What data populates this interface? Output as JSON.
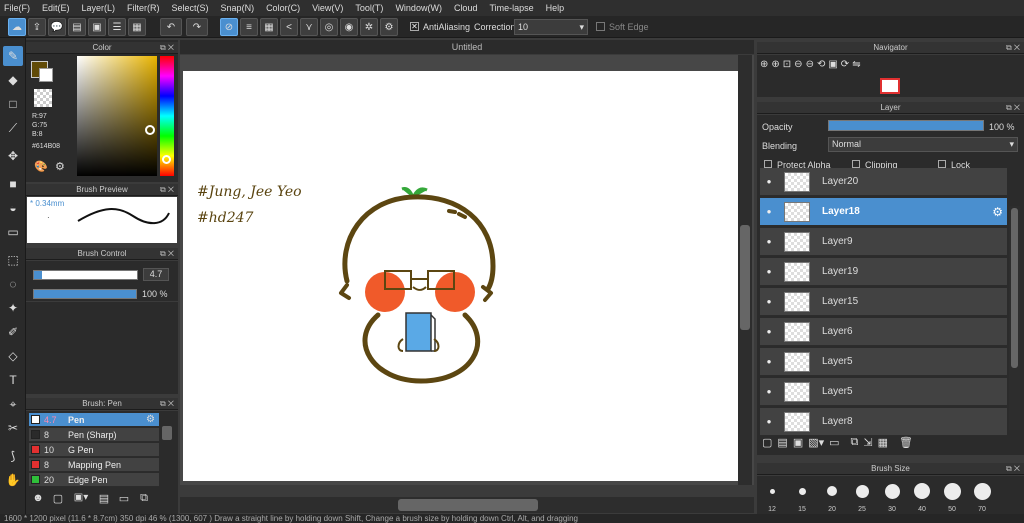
{
  "menu": [
    "File(F)",
    "Edit(E)",
    "Layer(L)",
    "Filter(R)",
    "Select(S)",
    "Snap(N)",
    "Color(C)",
    "View(V)",
    "Tool(T)",
    "Window(W)",
    "Cloud",
    "Time-lapse",
    "Help"
  ],
  "toolbar": {
    "antialias_label": "AntiAliasing",
    "correction_label": "Correction",
    "correction_value": "10",
    "soft_edge_label": "Soft Edge"
  },
  "color_panel": {
    "title": "Color",
    "r": "R:97",
    "g": "G:75",
    "b": "B:8",
    "hex": "#614B08",
    "main_color": "#614B08"
  },
  "brush_preview": {
    "title": "Brush Preview",
    "size": "0.34mm"
  },
  "brush_control": {
    "title": "Brush Control",
    "size_value": "4.7",
    "opacity_value": "100 %"
  },
  "brush_list": {
    "title": "Brush: Pen",
    "items": [
      {
        "size": "4.7",
        "name": "Pen",
        "color": "#ffffff"
      },
      {
        "size": "8",
        "name": "Pen (Sharp)",
        "color": "#2a2a2a"
      },
      {
        "size": "10",
        "name": "G Pen",
        "color": "#e33030"
      },
      {
        "size": "8",
        "name": "Mapping Pen",
        "color": "#e33030"
      },
      {
        "size": "20",
        "name": "Edge Pen",
        "color": "#2fbf3a"
      }
    ]
  },
  "canvas": {
    "tab_title": "Untitled",
    "handwriting_1": "#Jung, Jee Yeo",
    "handwriting_2": "#hd247"
  },
  "navigator": {
    "title": "Navigator"
  },
  "layer_panel": {
    "title": "Layer",
    "opacity_label": "Opacity",
    "opacity_value": "100 %",
    "blending_label": "Blending",
    "blending_value": "Normal",
    "protect_alpha": "Protect Alpha",
    "clipping": "Clipping",
    "lock": "Lock",
    "layers": [
      "Layer20",
      "Layer18",
      "Layer9",
      "Layer19",
      "Layer15",
      "Layer6",
      "Layer5",
      "Layer5",
      "Layer8"
    ]
  },
  "brush_size": {
    "title": "Brush Size",
    "sizes": [
      "12",
      "15",
      "20",
      "25",
      "30",
      "40",
      "50",
      "70"
    ]
  },
  "status_bar": "1600 * 1200 pixel  (11.6 * 8.7cm)  350 dpi  46 %  (1300, 607 )  Draw a straight line by holding down Shift, Change a brush size by holding down Ctrl, Alt, and dragging"
}
